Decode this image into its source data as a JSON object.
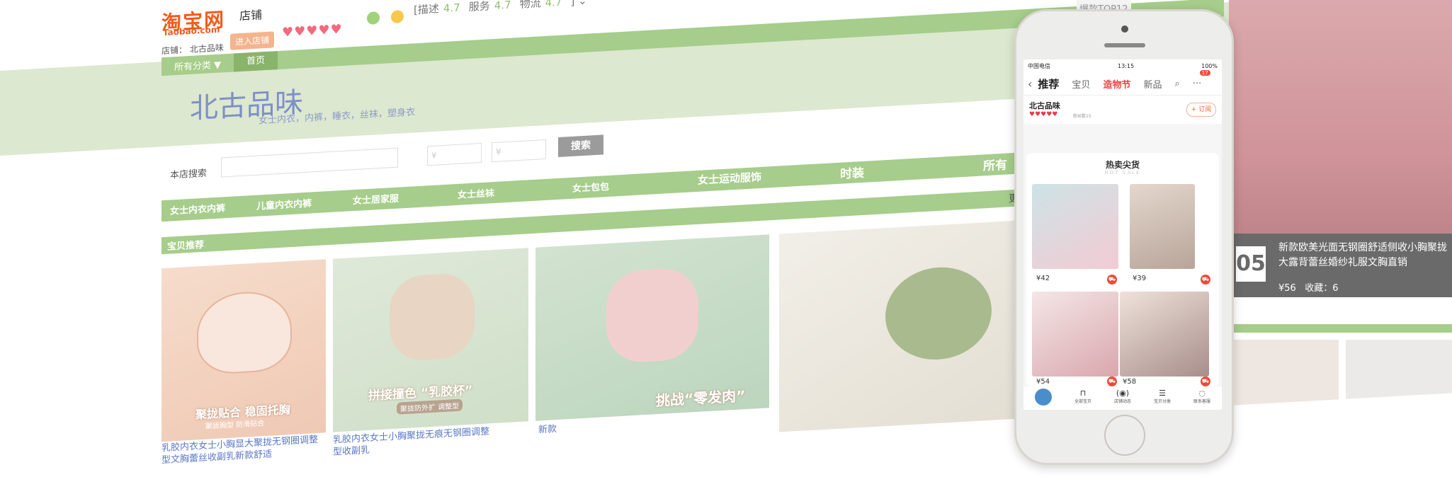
{
  "header": {
    "logo_cn": "淘宝网",
    "logo_en": "Taobao.com",
    "shop_tab": "店铺",
    "shop_label": "店铺： 北古品味",
    "enter_shop": "进入店铺",
    "hearts": "♥♥♥♥♥",
    "ratings": [
      {
        "label": "描述",
        "value": "4.7"
      },
      {
        "label": "服务",
        "value": "4.7"
      },
      {
        "label": "物流",
        "value": "4.7"
      }
    ]
  },
  "nav": {
    "all_categories": "所有分类 ▼",
    "home": "首页"
  },
  "banner": {
    "title": "北古品味",
    "subtitle": "女士内衣，内裤，睡衣，丝袜，塑身衣"
  },
  "search": {
    "label": "本店搜索",
    "price_symbol": "¥",
    "button": "搜索"
  },
  "categories": [
    "女士内衣内裤",
    "儿童内衣内裤",
    "女士居家服",
    "女士丝袜",
    "女士包包",
    "女士运动服饰",
    "时装",
    "所有"
  ],
  "recommend": {
    "label": "宝贝推荐",
    "more": "更"
  },
  "products": [
    {
      "tag": "聚拢贴合 稳固托胸",
      "tag_sub": "聚拢胸型 防滑贴合",
      "caption": "乳胶内衣女士小胸显大聚拢无钢圈调整型文胸蕾丝收副乳新款舒适"
    },
    {
      "tag": "拼接撞色 “乳胶杯”",
      "tag_sub": "聚拢防外扩 调整型",
      "caption": "乳胶内衣女士小胸聚拢无痕无钢圈调整型收副乳"
    },
    {
      "tag": "挑战“零发肉”",
      "tag_sub": "",
      "caption": "新款"
    },
    {
      "tag": "",
      "tag_sub": "",
      "caption": ""
    }
  ],
  "right_promo": {
    "top_label": "爆款TOP12",
    "rank": "05",
    "title": "新款欧美光面无钢圈舒适侧收小胸聚拢大露背蕾丝婚纱礼服文胸直销",
    "price": "¥56",
    "favorites": "收藏：",
    "favorites_count": "6"
  },
  "phone": {
    "status": {
      "carrier": "中国电信",
      "time": "13:15",
      "battery": "100%"
    },
    "tabs": [
      "推荐",
      "宝贝",
      "造物节",
      "新品"
    ],
    "badge": "17",
    "shop_name": "北古品味",
    "hearts": "♥♥♥♥♥",
    "fans": "粉丝数15",
    "subscribe": "+ 订阅",
    "hot_title": "热卖尖货",
    "hot_subtitle": "HOT SALE",
    "items": [
      {
        "price": "¥42"
      },
      {
        "price": "¥39"
      },
      {
        "price": "¥54"
      },
      {
        "price": "¥58"
      }
    ],
    "bottom_nav": [
      "全部宝贝",
      "店铺动态",
      "宝贝分类",
      "联系客服"
    ]
  },
  "colors": {
    "brand": "#f25a1e",
    "green": "#a6cd8b",
    "title_blue": "#7e8fc8",
    "heart": "#f36a7d"
  }
}
